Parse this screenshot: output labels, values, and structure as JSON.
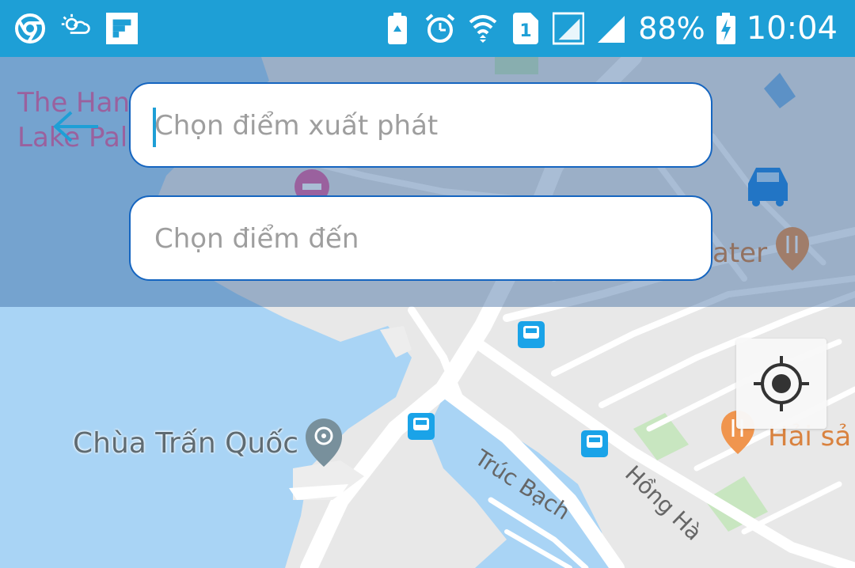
{
  "status_bar": {
    "battery_percent": "88%",
    "time": "10:04",
    "sim_slot": "1",
    "left_icons": [
      "chrome-icon",
      "weather-icon",
      "flipboard-icon"
    ],
    "right_icons": [
      "battery-saver-icon",
      "alarm-icon",
      "wifi-icon",
      "sim-icon",
      "signal-icon",
      "signal-icon",
      "charging-battery-icon"
    ]
  },
  "search": {
    "origin_placeholder": "Chọn điểm xuất phát",
    "destination_placeholder": "Chọn điểm đến"
  },
  "map": {
    "labels": {
      "hanoi_lake_palace_line1": "The Han",
      "hanoi_lake_palace_line2": "Lake Pal",
      "water_restaurant": "ater",
      "tran_quoc_pagoda": "Chùa Trấn Quốc",
      "truc_bach": "Trúc Bạch",
      "hong_ha": "Hồng Hà",
      "hai_san": "Hải sả"
    },
    "colors": {
      "water": "#a9d4f5",
      "land": "#e8e8e8",
      "road": "#ffffff",
      "park": "#c8e6c0",
      "status_bar": "#1e9fd6",
      "input_border": "#1565c0",
      "restaurant_pin": "#f0954e",
      "bus_stop": "#1aa3e8"
    }
  }
}
